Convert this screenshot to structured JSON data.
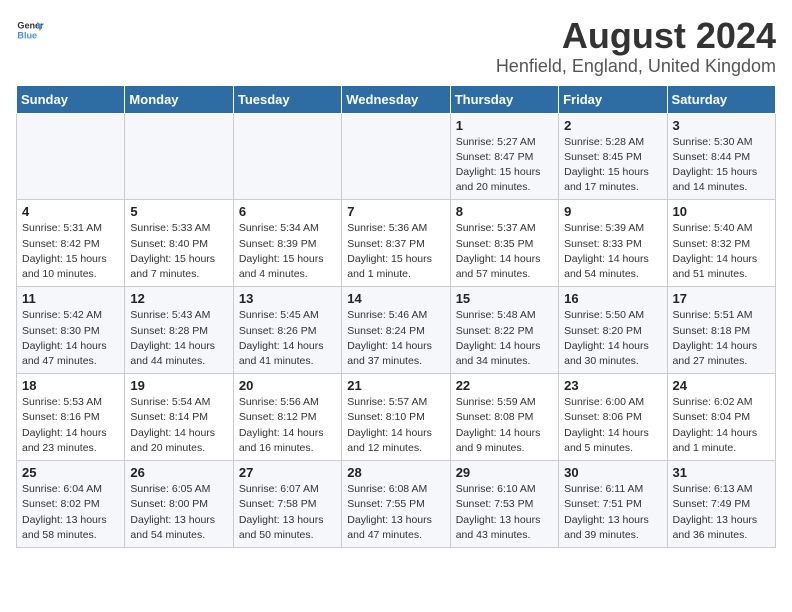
{
  "header": {
    "logo_general": "General",
    "logo_blue": "Blue",
    "title": "August 2024",
    "subtitle": "Henfield, England, United Kingdom"
  },
  "days_of_week": [
    "Sunday",
    "Monday",
    "Tuesday",
    "Wednesday",
    "Thursday",
    "Friday",
    "Saturday"
  ],
  "weeks": [
    [
      {
        "day": "",
        "info": ""
      },
      {
        "day": "",
        "info": ""
      },
      {
        "day": "",
        "info": ""
      },
      {
        "day": "",
        "info": ""
      },
      {
        "day": "1",
        "info": "Sunrise: 5:27 AM\nSunset: 8:47 PM\nDaylight: 15 hours\nand 20 minutes."
      },
      {
        "day": "2",
        "info": "Sunrise: 5:28 AM\nSunset: 8:45 PM\nDaylight: 15 hours\nand 17 minutes."
      },
      {
        "day": "3",
        "info": "Sunrise: 5:30 AM\nSunset: 8:44 PM\nDaylight: 15 hours\nand 14 minutes."
      }
    ],
    [
      {
        "day": "4",
        "info": "Sunrise: 5:31 AM\nSunset: 8:42 PM\nDaylight: 15 hours\nand 10 minutes."
      },
      {
        "day": "5",
        "info": "Sunrise: 5:33 AM\nSunset: 8:40 PM\nDaylight: 15 hours\nand 7 minutes."
      },
      {
        "day": "6",
        "info": "Sunrise: 5:34 AM\nSunset: 8:39 PM\nDaylight: 15 hours\nand 4 minutes."
      },
      {
        "day": "7",
        "info": "Sunrise: 5:36 AM\nSunset: 8:37 PM\nDaylight: 15 hours\nand 1 minute."
      },
      {
        "day": "8",
        "info": "Sunrise: 5:37 AM\nSunset: 8:35 PM\nDaylight: 14 hours\nand 57 minutes."
      },
      {
        "day": "9",
        "info": "Sunrise: 5:39 AM\nSunset: 8:33 PM\nDaylight: 14 hours\nand 54 minutes."
      },
      {
        "day": "10",
        "info": "Sunrise: 5:40 AM\nSunset: 8:32 PM\nDaylight: 14 hours\nand 51 minutes."
      }
    ],
    [
      {
        "day": "11",
        "info": "Sunrise: 5:42 AM\nSunset: 8:30 PM\nDaylight: 14 hours\nand 47 minutes."
      },
      {
        "day": "12",
        "info": "Sunrise: 5:43 AM\nSunset: 8:28 PM\nDaylight: 14 hours\nand 44 minutes."
      },
      {
        "day": "13",
        "info": "Sunrise: 5:45 AM\nSunset: 8:26 PM\nDaylight: 14 hours\nand 41 minutes."
      },
      {
        "day": "14",
        "info": "Sunrise: 5:46 AM\nSunset: 8:24 PM\nDaylight: 14 hours\nand 37 minutes."
      },
      {
        "day": "15",
        "info": "Sunrise: 5:48 AM\nSunset: 8:22 PM\nDaylight: 14 hours\nand 34 minutes."
      },
      {
        "day": "16",
        "info": "Sunrise: 5:50 AM\nSunset: 8:20 PM\nDaylight: 14 hours\nand 30 minutes."
      },
      {
        "day": "17",
        "info": "Sunrise: 5:51 AM\nSunset: 8:18 PM\nDaylight: 14 hours\nand 27 minutes."
      }
    ],
    [
      {
        "day": "18",
        "info": "Sunrise: 5:53 AM\nSunset: 8:16 PM\nDaylight: 14 hours\nand 23 minutes."
      },
      {
        "day": "19",
        "info": "Sunrise: 5:54 AM\nSunset: 8:14 PM\nDaylight: 14 hours\nand 20 minutes."
      },
      {
        "day": "20",
        "info": "Sunrise: 5:56 AM\nSunset: 8:12 PM\nDaylight: 14 hours\nand 16 minutes."
      },
      {
        "day": "21",
        "info": "Sunrise: 5:57 AM\nSunset: 8:10 PM\nDaylight: 14 hours\nand 12 minutes."
      },
      {
        "day": "22",
        "info": "Sunrise: 5:59 AM\nSunset: 8:08 PM\nDaylight: 14 hours\nand 9 minutes."
      },
      {
        "day": "23",
        "info": "Sunrise: 6:00 AM\nSunset: 8:06 PM\nDaylight: 14 hours\nand 5 minutes."
      },
      {
        "day": "24",
        "info": "Sunrise: 6:02 AM\nSunset: 8:04 PM\nDaylight: 14 hours\nand 1 minute."
      }
    ],
    [
      {
        "day": "25",
        "info": "Sunrise: 6:04 AM\nSunset: 8:02 PM\nDaylight: 13 hours\nand 58 minutes."
      },
      {
        "day": "26",
        "info": "Sunrise: 6:05 AM\nSunset: 8:00 PM\nDaylight: 13 hours\nand 54 minutes."
      },
      {
        "day": "27",
        "info": "Sunrise: 6:07 AM\nSunset: 7:58 PM\nDaylight: 13 hours\nand 50 minutes."
      },
      {
        "day": "28",
        "info": "Sunrise: 6:08 AM\nSunset: 7:55 PM\nDaylight: 13 hours\nand 47 minutes."
      },
      {
        "day": "29",
        "info": "Sunrise: 6:10 AM\nSunset: 7:53 PM\nDaylight: 13 hours\nand 43 minutes."
      },
      {
        "day": "30",
        "info": "Sunrise: 6:11 AM\nSunset: 7:51 PM\nDaylight: 13 hours\nand 39 minutes."
      },
      {
        "day": "31",
        "info": "Sunrise: 6:13 AM\nSunset: 7:49 PM\nDaylight: 13 hours\nand 36 minutes."
      }
    ]
  ]
}
